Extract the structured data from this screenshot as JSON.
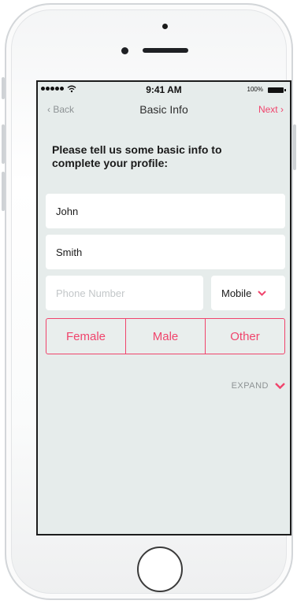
{
  "status_bar": {
    "time": "9:41 AM",
    "battery": "100%",
    "wifi_icon": "wifi-icon",
    "signal_icon": "signal-dots-icon"
  },
  "nav": {
    "back_label": "Back",
    "title": "Basic Info",
    "next_label": "Next"
  },
  "form": {
    "prompt": "Please tell us some basic info to complete your profile:",
    "first_name": "John",
    "last_name": "Smith",
    "phone_placeholder": "Phone Number",
    "phone_value": "",
    "phone_type": "Mobile",
    "gender_options": [
      "Female",
      "Male",
      "Other"
    ],
    "expand_label": "EXPAND"
  },
  "colors": {
    "accent": "#f0446c",
    "screen_bg": "#e6eceb",
    "muted_text": "#8d9294"
  }
}
